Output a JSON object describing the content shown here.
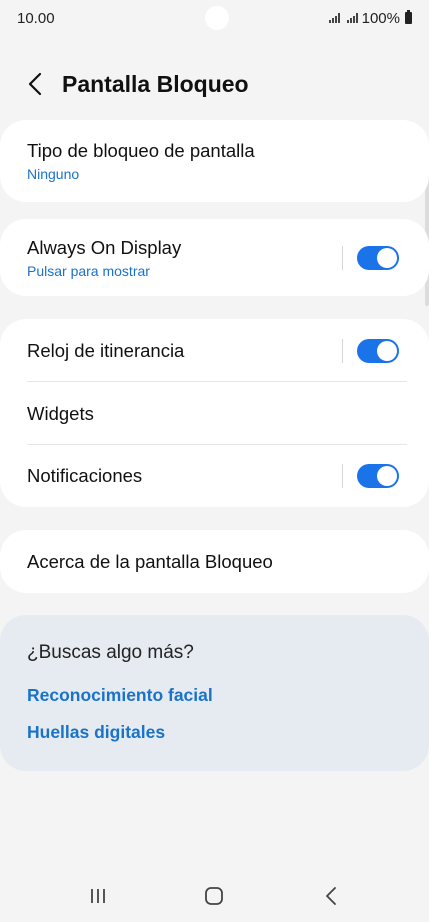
{
  "status_bar": {
    "time": "10.00",
    "battery": "100%"
  },
  "header": {
    "title": "Pantalla Bloqueo",
    "back_icon": "chevron-left-icon"
  },
  "settings": {
    "lock_type": {
      "title": "Tipo de bloqueo de pantalla",
      "value": "Ninguno"
    },
    "always_on": {
      "title": "Always On Display",
      "subtitle": "Pulsar para mostrar",
      "enabled": true
    },
    "roaming_clock": {
      "title": "Reloj de itinerancia",
      "enabled": true
    },
    "widgets": {
      "title": "Widgets"
    },
    "notifications": {
      "title": "Notificaciones",
      "enabled": true
    },
    "about": {
      "title": "Acerca de la pantalla Bloqueo"
    }
  },
  "suggestions": {
    "title": "¿Buscas algo más?",
    "links": [
      "Reconocimiento facial",
      "Huellas digitales"
    ]
  },
  "colors": {
    "accent": "#1a73e8",
    "link": "#1a73c8",
    "background": "#f4f4f4",
    "suggest_bg": "#e6ebf1"
  },
  "nav_bar": {
    "icons": [
      "recents-icon",
      "home-icon",
      "back-icon"
    ]
  }
}
